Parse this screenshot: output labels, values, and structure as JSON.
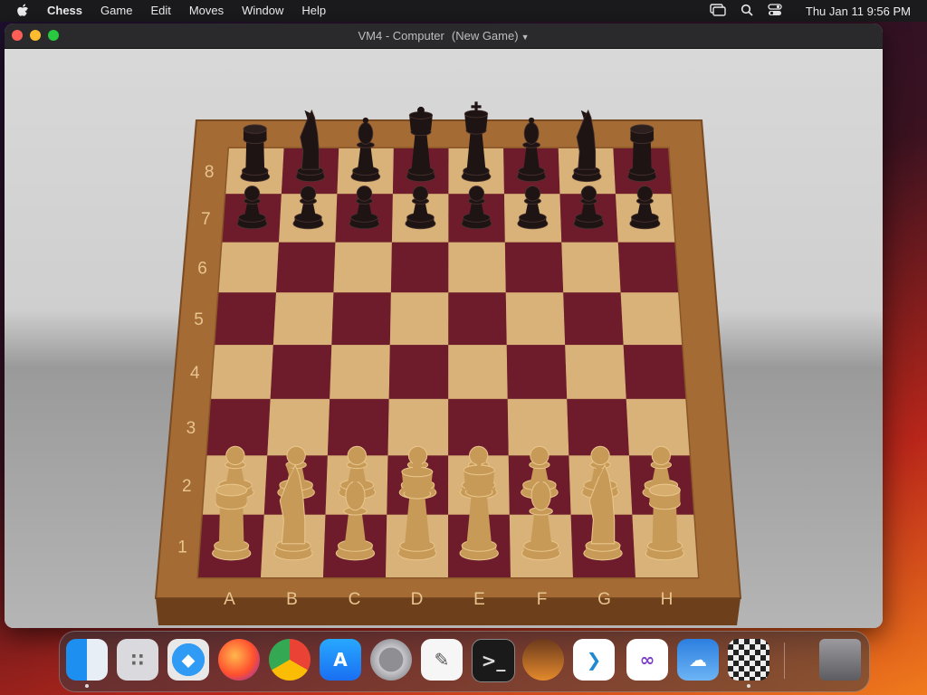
{
  "menubar": {
    "app_name": "Chess",
    "menus": [
      "Game",
      "Edit",
      "Moves",
      "Window",
      "Help"
    ],
    "clock": "Thu Jan 11  9:56 PM",
    "status_icons": [
      "screen-mirroring-icon",
      "search-icon",
      "control-center-icon"
    ]
  },
  "window": {
    "title": "VM4 - Computer",
    "subtitle": "(New Game)"
  },
  "board": {
    "ranks": [
      "8",
      "7",
      "6",
      "5",
      "4",
      "3",
      "2",
      "1"
    ],
    "files": [
      "A",
      "B",
      "C",
      "D",
      "E",
      "F",
      "G",
      "H"
    ],
    "back_rank": [
      "rook",
      "knight",
      "bishop",
      "queen",
      "king",
      "bishop",
      "knight",
      "rook"
    ],
    "colors": {
      "dark_square": "#6e1c2c",
      "light_square": "#d9b27a",
      "frame": "#a46b35",
      "black_piece": "#1e1414",
      "white_piece": "#c79a58"
    }
  },
  "dock": {
    "apps": [
      {
        "name": "Finder",
        "icon": "finder-icon",
        "running": true
      },
      {
        "name": "Launchpad",
        "icon": "launchpad-icon",
        "running": false
      },
      {
        "name": "Safari",
        "icon": "safari-icon",
        "running": false
      },
      {
        "name": "Firefox",
        "icon": "firefox-icon",
        "running": false
      },
      {
        "name": "Chrome",
        "icon": "chrome-icon",
        "running": false
      },
      {
        "name": "App Store",
        "icon": "app-store-icon",
        "running": false
      },
      {
        "name": "System Settings",
        "icon": "settings-icon",
        "running": false
      },
      {
        "name": "TextEdit",
        "icon": "textedit-icon",
        "running": false
      },
      {
        "name": "Terminal",
        "icon": "terminal-icon",
        "running": false
      },
      {
        "name": "GarageBand",
        "icon": "garageband-icon",
        "running": false
      },
      {
        "name": "VS Code",
        "icon": "vscode-icon",
        "running": false
      },
      {
        "name": "Visual Studio",
        "icon": "visual-studio-icon",
        "running": false
      },
      {
        "name": "Weather",
        "icon": "weather-icon",
        "running": false
      },
      {
        "name": "Chess",
        "icon": "chess-icon",
        "running": true
      },
      {
        "name": "Trash",
        "icon": "trash-icon",
        "running": false
      }
    ]
  }
}
